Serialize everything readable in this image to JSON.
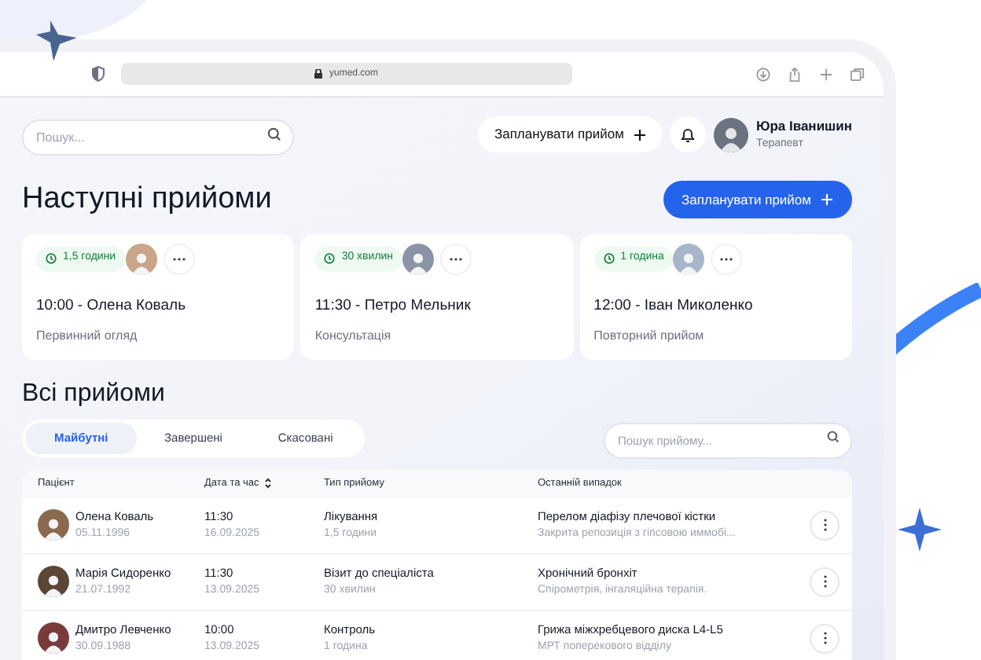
{
  "browser": {
    "url": "yumed.com"
  },
  "header": {
    "search_placeholder": "Пошук...",
    "schedule_button": "Запланувати прийом",
    "user": {
      "name": "Юра Іванишин",
      "role": "Терапевт"
    }
  },
  "upcoming": {
    "title": "Наступні прийоми",
    "button": "Запланувати прийом",
    "cards": [
      {
        "duration": "1,5 години",
        "title": "10:00 - Олена Коваль",
        "type": "Первинний огляд"
      },
      {
        "duration": "30 хвилин",
        "title": "11:30 - Петро Мельник",
        "type": "Консультація"
      },
      {
        "duration": "1 година",
        "title": "12:00 - Іван Миколенко",
        "type": "Повторний прийом"
      }
    ]
  },
  "all": {
    "title": "Всі прийоми",
    "tabs": [
      {
        "label": "Майбутні",
        "selected": true
      },
      {
        "label": "Завершені",
        "selected": false
      },
      {
        "label": "Скасовані",
        "selected": false
      }
    ],
    "search_placeholder": "Пошук прийому...",
    "columns": [
      "Пацієнт",
      "Дата та час",
      "Тип прийому",
      "Останній випадок"
    ],
    "rows": [
      {
        "name": "Олена Коваль",
        "dob": "05.11.1996",
        "time": "11:30",
        "date": "16.09.2025",
        "type": "Лікування",
        "duration": "1,5 години",
        "case": "Перелом діафізу плечової кістки",
        "note": "Закрита репозиція з гіпсовою иммобі..."
      },
      {
        "name": "Марія Сидоренко",
        "dob": "21.07.1992",
        "time": "11:30",
        "date": "13.09.2025",
        "type": "Візит до спеціаліста",
        "duration": "30 хвилин",
        "case": "Хронічний бронхіт",
        "note": "Спірометрія, інгаляційна терапія."
      },
      {
        "name": "Дмитро Левченко",
        "dob": "30.09.1988",
        "time": "10:00",
        "date": "13.09.2025",
        "type": "Контроль",
        "duration": "1 година",
        "case": "Грижа міжхребцевого диска L4-L5",
        "note": "МРТ поперекового відділу"
      }
    ]
  }
}
